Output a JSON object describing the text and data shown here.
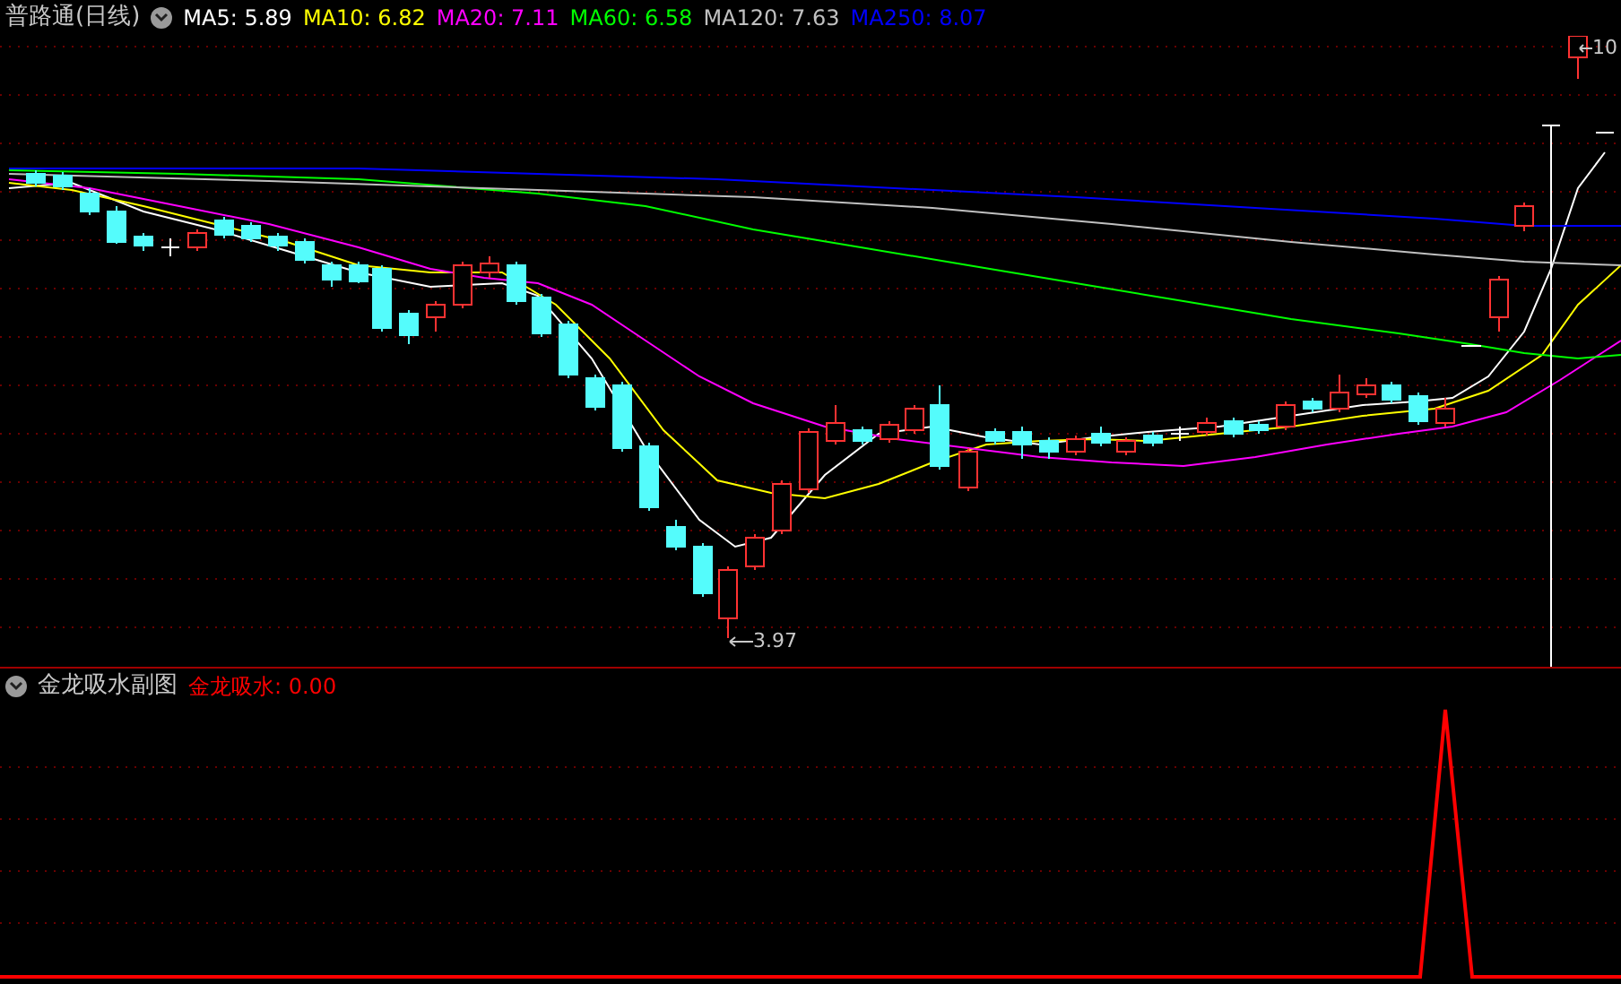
{
  "main_panel": {
    "title": "普路通(日线)",
    "indicators": [
      {
        "label": "MA5: 5.89",
        "color": "#ffffff"
      },
      {
        "label": "MA10: 6.82",
        "color": "#ffff00"
      },
      {
        "label": "MA20: 7.11",
        "color": "#ff00ff"
      },
      {
        "label": "MA60: 6.58",
        "color": "#00ff00"
      },
      {
        "label": "MA120: 7.63",
        "color": "#c0c0c0"
      },
      {
        "label": "MA250: 8.07",
        "color": "#0000ff"
      }
    ],
    "low_price_label": "3.97",
    "high_price_label": "10"
  },
  "sub_panel": {
    "title": "金龙吸水副图",
    "indicators": [
      {
        "label": "金龙吸水: 0.00",
        "color": "#ff0000"
      }
    ]
  }
}
